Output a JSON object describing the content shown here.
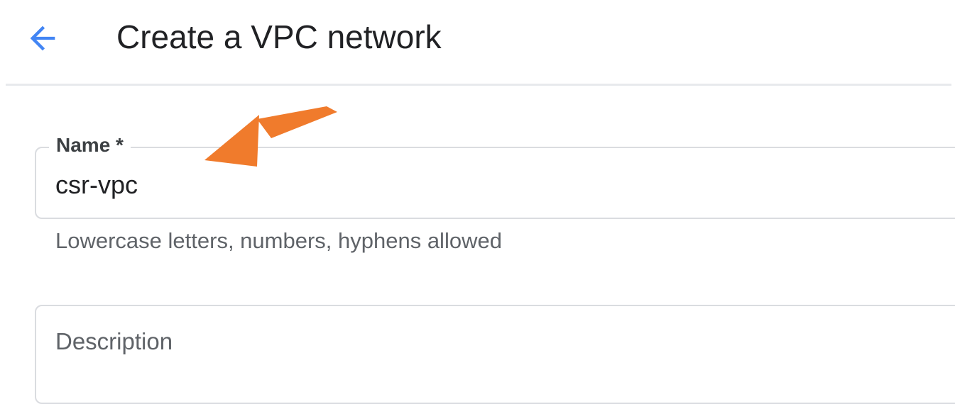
{
  "header": {
    "title": "Create a VPC network",
    "back_icon": "arrow-back-icon"
  },
  "form": {
    "name": {
      "label": "Name *",
      "value": "csr-vpc",
      "helper": "Lowercase letters, numbers, hyphens allowed"
    },
    "description": {
      "placeholder": "Description",
      "value": ""
    }
  },
  "annotation": {
    "icon": "annotation-arrow-icon",
    "color": "#f07b2c"
  },
  "colors": {
    "accent": "#4285f4",
    "title_text": "#202124",
    "secondary_text": "#5f6368",
    "border": "#dadce0"
  }
}
